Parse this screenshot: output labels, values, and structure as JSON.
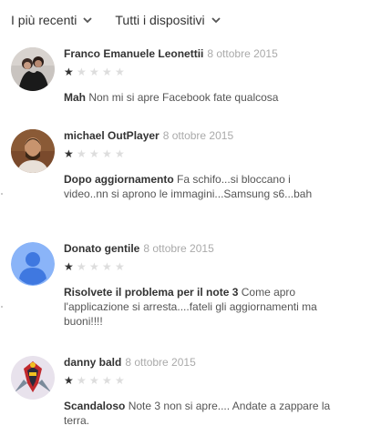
{
  "filters": {
    "sort_label": "I più recenti",
    "devices_label": "Tutti i dispositivi"
  },
  "reviews": [
    {
      "author": "Franco Emanuele Leonettii",
      "date": "8 ottobre 2015",
      "rating": 1,
      "title": "Mah",
      "text": "Non mi si apre Facebook fate qualcosa"
    },
    {
      "author": "michael OutPlayer",
      "date": "8 ottobre 2015",
      "rating": 1,
      "title": "Dopo aggiornamento",
      "text": "Fa schifo...si bloccano i video..nn si aprono le immagini...Samsung s6...bah"
    },
    {
      "author": "Donato gentile",
      "date": "8 ottobre 2015",
      "rating": 1,
      "title": "Risolvete il problema per il note 3",
      "text": "Come apro l'applicazione si arresta....fateli gli aggiornamenti ma buoni!!!!"
    },
    {
      "author": "danny bald",
      "date": "8 ottobre 2015",
      "rating": 1,
      "title": "Scandaloso",
      "text": "Note 3 non si apre.... Andate a zappare la terra."
    }
  ],
  "colors": {
    "default_avatar": "#8ab4f8",
    "rating_star": "#333333",
    "empty_star": "#dddddd"
  }
}
